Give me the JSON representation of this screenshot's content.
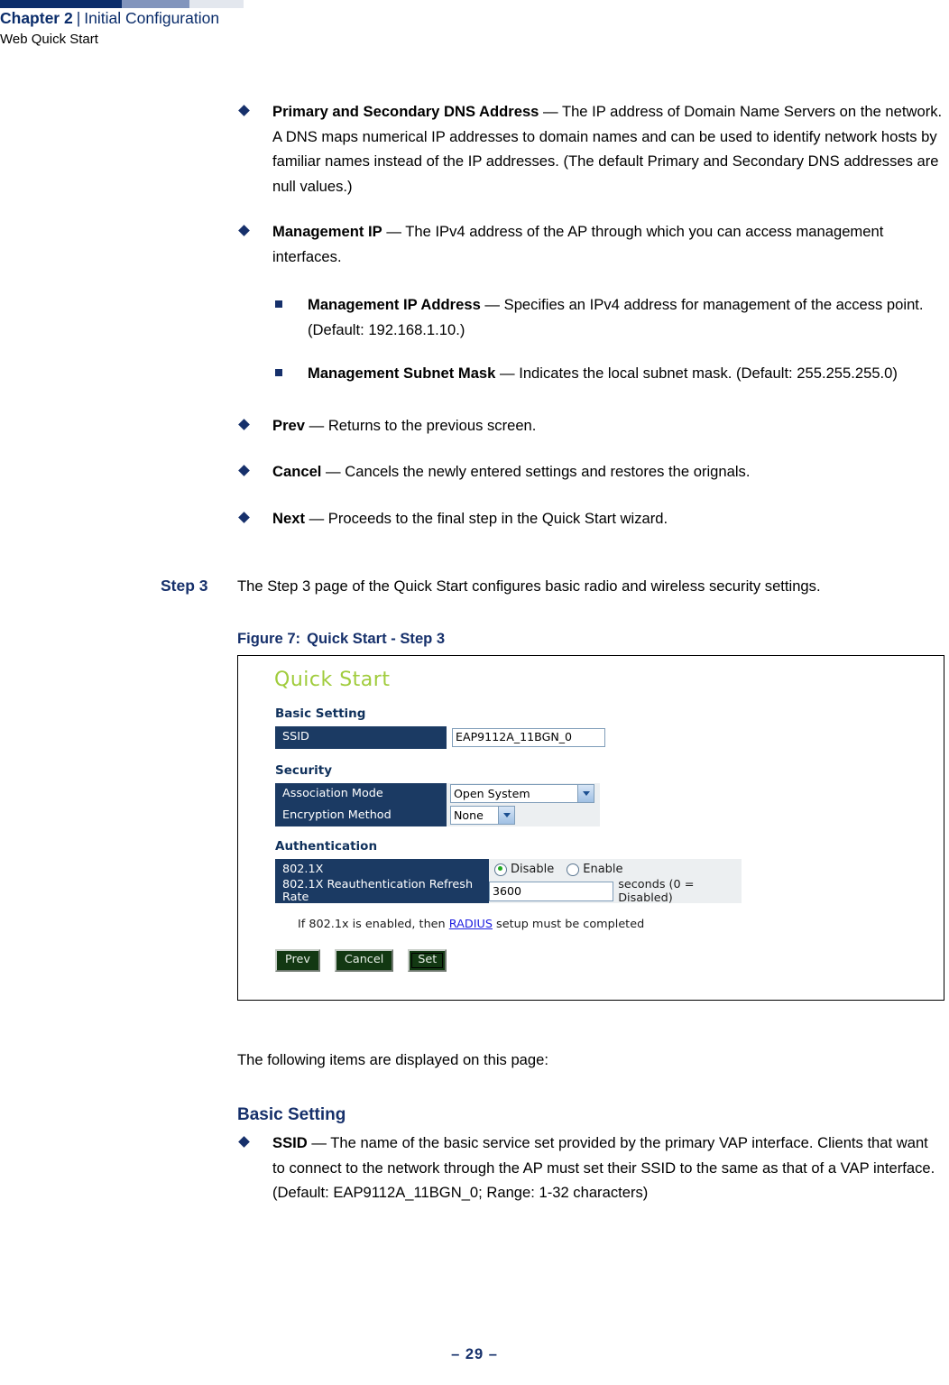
{
  "running_head": {
    "chapter": "Chapter 2",
    "separator": "|",
    "chapter_title": "Initial Configuration",
    "section": "Web Quick Start"
  },
  "bullets": [
    {
      "term": "Primary and Secondary DNS Address",
      "dash": " — ",
      "text": "The IP address of Domain Name Servers on the network. A DNS maps numerical IP addresses to domain names and can be used to identify network hosts by familiar names instead of the IP addresses. (The default Primary and Secondary DNS addresses are null values.)"
    },
    {
      "term": "Management IP",
      "dash": " — ",
      "text": "The IPv4 address of the AP through which you can access management interfaces."
    }
  ],
  "sub_bullets": [
    {
      "term": "Management IP Address",
      "dash": " — ",
      "text": "Specifies an IPv4 address for management of the access point. (Default: 192.168.1.10.)"
    },
    {
      "term": "Management Subnet Mask",
      "dash": " — ",
      "text": "Indicates the local subnet mask. (Default: 255.255.255.0)"
    }
  ],
  "bullets2": [
    {
      "term": "Prev",
      "dash": " — ",
      "text": "Returns to the previous screen."
    },
    {
      "term": "Cancel",
      "dash": " — ",
      "text": "Cancels the newly entered settings and restores the orignals."
    },
    {
      "term": "Next",
      "dash": " — ",
      "text": "Proceeds to the final step in the Quick Start wizard."
    }
  ],
  "step": {
    "label": "Step 3",
    "text": "The Step 3 page of the Quick Start configures basic radio and wireless security settings."
  },
  "figure": {
    "caption_number": "Figure 7:",
    "caption_title": "Quick Start - Step 3",
    "ui": {
      "title": "Quick Start",
      "sections": {
        "basic": "Basic Setting",
        "security": "Security",
        "authentication": "Authentication"
      },
      "rows": {
        "ssid_label": "SSID",
        "ssid_value": "EAP9112A_11BGN_0",
        "assoc_label": "Association Mode",
        "assoc_value": "Open System",
        "encrypt_label": "Encryption Method",
        "encrypt_value": "None",
        "dot1x_label": "802.1X",
        "dot1x_disable": "Disable",
        "dot1x_enable": "Enable",
        "refresh_label": "802.1X Reauthentication Refresh Rate",
        "refresh_value": "3600",
        "refresh_units": "seconds (0 = Disabled)"
      },
      "note_prefix": "If 802.1x is enabled, then ",
      "note_link": "RADIUS",
      "note_suffix": " setup must be completed",
      "buttons": {
        "prev": "Prev",
        "cancel": "Cancel",
        "set": "Set"
      },
      "colors": {
        "title_green": "#a0cc3c",
        "label_navy": "#1b3a63",
        "value_gray": "#eceff1",
        "button_green": "#123812",
        "link_blue": "#2020e0",
        "radio_selected": "#1faa1f"
      }
    }
  },
  "after_figure": "The following items are displayed on this page:",
  "sub_heading": "Basic Setting",
  "final_bullet": {
    "term": "SSID",
    "dash": " — ",
    "text": "The name of the basic service set provided by the primary VAP interface. Clients that want to connect to the network through the AP must set their SSID to the same as that of a VAP interface.",
    "default_line": "(Default: EAP9112A_11BGN_0; Range: 1-32 characters)"
  },
  "footer": {
    "page": "–  29  –"
  },
  "theme": {
    "navy": "#16306b",
    "header_navy": "#0b2d6b",
    "header_mid": "#8295bd",
    "header_light": "#e3e7ee"
  }
}
